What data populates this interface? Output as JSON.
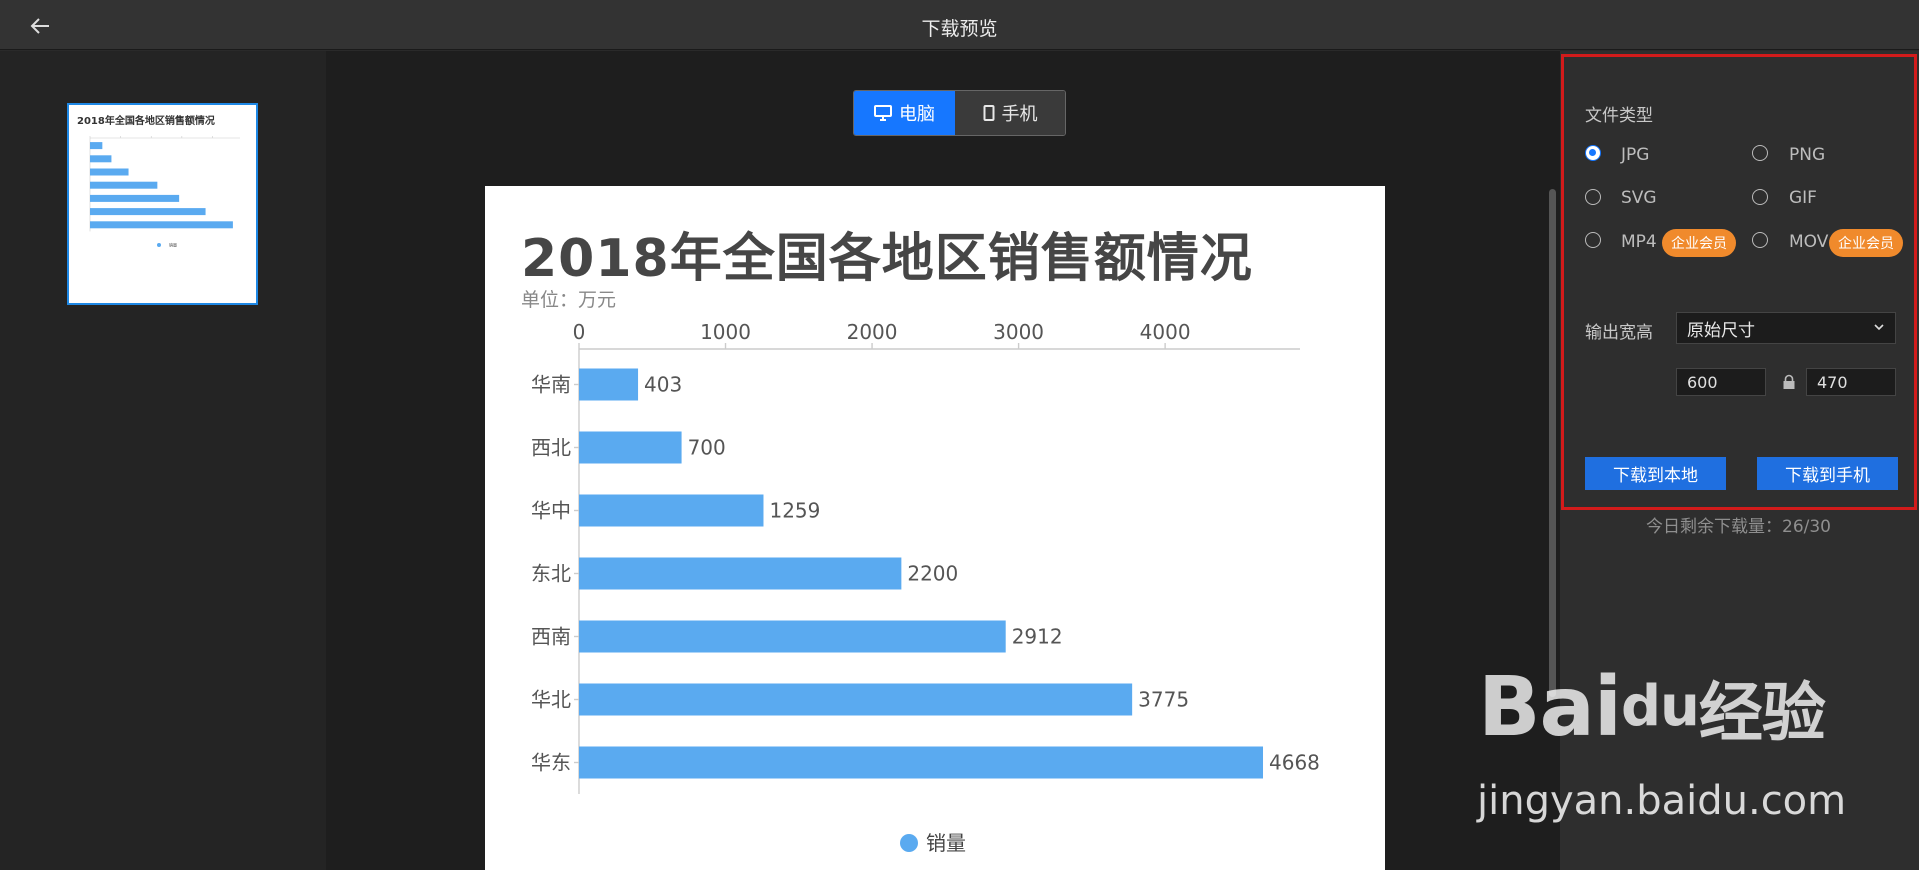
{
  "topbar": {
    "title": "下载预览",
    "back_icon": "arrow-left-icon"
  },
  "device_tabs": [
    {
      "label": "电脑",
      "icon": "monitor-icon",
      "active": true
    },
    {
      "label": "手机",
      "icon": "phone-icon",
      "active": false
    }
  ],
  "thumbnail": {
    "title": "2018年全国各地区销售额情况"
  },
  "chart": {
    "title": "2018年全国各地区销售额情况",
    "subtitle": "单位：万元"
  },
  "chart_data": {
    "type": "bar",
    "orientation": "horizontal",
    "title": "2018年全国各地区销售额情况",
    "subtitle": "单位：万元",
    "categories": [
      "华南",
      "西北",
      "华中",
      "东北",
      "西南",
      "华北",
      "华东"
    ],
    "series": [
      {
        "name": "销量",
        "values": [
          403,
          700,
          1259,
          2200,
          2912,
          3775,
          4668
        ],
        "color": "#5aaaf0"
      }
    ],
    "x_ticks": [
      0,
      1000,
      2000,
      3000,
      4000
    ],
    "xlim": [
      0,
      4900
    ],
    "data_labels": true,
    "grid": false,
    "legend": "bottom-center"
  },
  "settings": {
    "file_type_label": "文件类型",
    "file_types": [
      {
        "label": "JPG",
        "checked": true
      },
      {
        "label": "PNG",
        "checked": false
      },
      {
        "label": "SVG",
        "checked": false
      },
      {
        "label": "GIF",
        "checked": false
      },
      {
        "label": "MP4",
        "checked": false,
        "badge": "企业会员"
      },
      {
        "label": "MOV",
        "checked": false,
        "badge": "企业会员"
      }
    ],
    "output_size_label": "输出宽高",
    "size_select": "原始尺寸",
    "width": "600",
    "height": "470",
    "download_local": "下载到本地",
    "download_phone": "下载到手机",
    "quota_text": "今日剩余下载量：26/30"
  },
  "watermark": {
    "logo": "Bai",
    "logo_suffix": "经验",
    "logo_paw": "du",
    "url": "jingyan.baidu.com"
  },
  "colors": {
    "accent": "#1677ff",
    "bar": "#5aaaf0",
    "badge": "#f08a2c",
    "highlight_box": "#d21b1b"
  }
}
